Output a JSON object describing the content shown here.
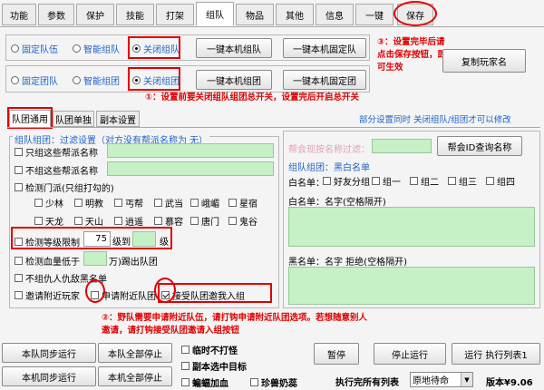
{
  "tabs": [
    "功能",
    "参数",
    "保护",
    "技能",
    "打架",
    "组队",
    "物品",
    "其他",
    "信息",
    "一键",
    "保存"
  ],
  "top": {
    "row1": {
      "fixed": "固定队伍",
      "smart": "智能组队",
      "close": "关闭组队",
      "btn1": "一键本机组队",
      "btn2": "一键本机固定队"
    },
    "row2": {
      "fixed": "固定团队",
      "smart": "智能组团",
      "close": "关闭组团",
      "btn1": "一键本机组团",
      "btn2": "一键本机固定团"
    },
    "copy_button": "复制玩家名",
    "note3": "③：设置完毕后请点击保存按钮，即可生效",
    "note1": "①：设置前要关闭组队组团总开关，设置完后开启总开关"
  },
  "subtabs": [
    "队团通用",
    "队团单独",
    "副本设置"
  ],
  "hint_right": "部分设置同时 关闭组队/组团才可以修改",
  "left": {
    "title": "组队组团：过滤设置（对方没有帮派名称为 无）",
    "only_faction": "只组这些帮派名称",
    "not_faction": "不组这些帮派名称",
    "check_sect": "检测门派(只组打勾的)",
    "sects_row1": [
      "少林",
      "明教",
      "丐帮",
      "武当",
      "峨嵋",
      "星宿"
    ],
    "sects_row2": [
      "天龙",
      "天山",
      "逍遥",
      "慕容",
      "唐门",
      "鬼谷"
    ],
    "level_limit": "检测等级限制",
    "level_from": "75",
    "level_mid": "级到",
    "level_to": "",
    "level_end": "级",
    "hp_low": "检测血量低于",
    "hp_suffix": "万)踢出队团",
    "no_enemy": "不组仇人仇敌黑名单",
    "invite_near": "邀请附近玩家",
    "apply_near": "申请附近队团",
    "accept_invite": "接受队团邀我入组"
  },
  "right": {
    "help_text": "帮会现按名称过滤：",
    "help_btn": "帮会ID查询名称",
    "bw_title": "组队组团：黑白名单",
    "white_label": "白名单：",
    "friends": "好友分组",
    "groups": [
      "组一",
      "组二",
      "组三",
      "组四"
    ],
    "white_names": "白名单：名字(空格隔开)",
    "black_names": "黑名单：名字 拒绝(空格隔开)"
  },
  "note2": "②：野队需要申请附近队伍，请打钩申请附近队团选项。若想随意别人邀请，请打钩接受队团邀请入组按钮",
  "bottom": {
    "sync1": "本队同步运行",
    "stopall1": "本队全部停止",
    "sync2": "本机同步运行",
    "stopall2": "本机全部停止",
    "opt1": "临时不打怪",
    "opt2": "副本选中目标",
    "opt3": "蝙蝠加血",
    "opt4": "珍兽奶蕊",
    "pause": "暂停",
    "stop": "停止运行",
    "run_list": "运行 执行列表1",
    "exec_label": "执行完所有列表",
    "select_value": "原地待命",
    "version": "版本¥9.06"
  }
}
